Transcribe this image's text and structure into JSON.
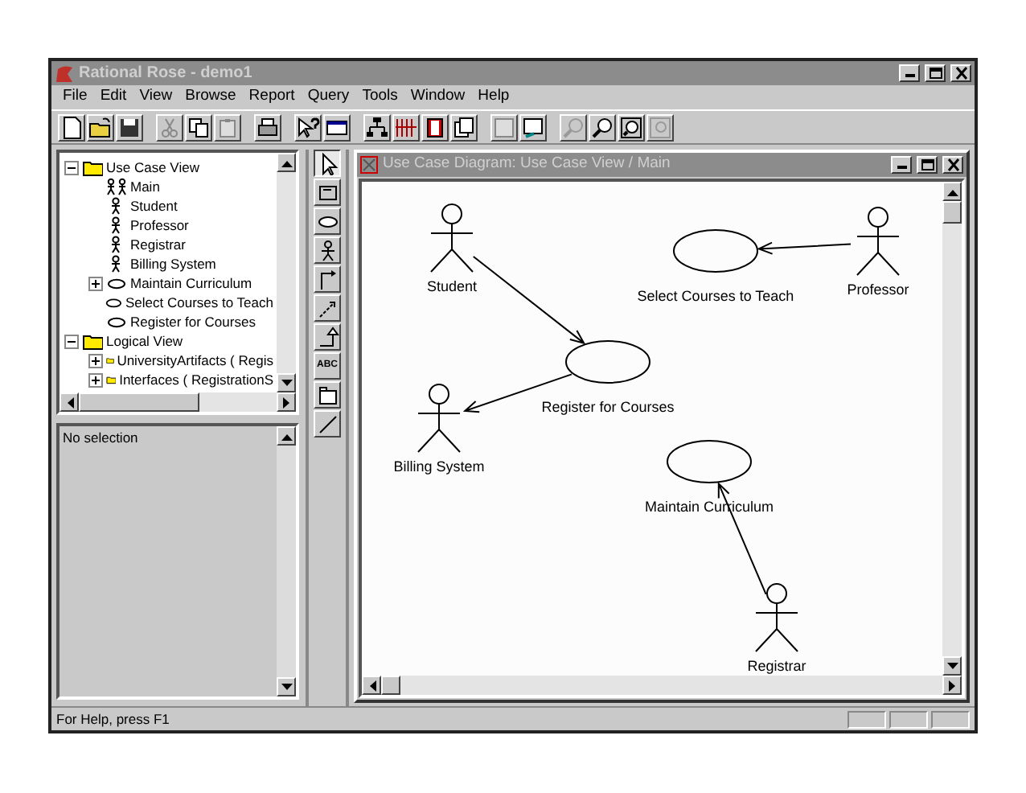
{
  "window": {
    "title": "Rational Rose - demo1"
  },
  "menu": [
    "File",
    "Edit",
    "View",
    "Browse",
    "Report",
    "Query",
    "Tools",
    "Window",
    "Help"
  ],
  "browser": {
    "tree": [
      {
        "label": "Use Case View",
        "kind": "folder",
        "expanded": true,
        "children": [
          {
            "label": "Main",
            "kind": "diagram"
          },
          {
            "label": "Student",
            "kind": "actor"
          },
          {
            "label": "Professor",
            "kind": "actor"
          },
          {
            "label": "Registrar",
            "kind": "actor"
          },
          {
            "label": "Billing System",
            "kind": "actor"
          },
          {
            "label": "Maintain Curriculum",
            "kind": "usecase",
            "expanded": false
          },
          {
            "label": "Select Courses to Teach",
            "kind": "usecase"
          },
          {
            "label": "Register for Courses",
            "kind": "usecase"
          }
        ]
      },
      {
        "label": "Logical View",
        "kind": "folder",
        "expanded": true,
        "children": [
          {
            "label": "UniversityArtifacts ( Regis",
            "kind": "folder",
            "expanded": false
          },
          {
            "label": "Interfaces ( RegistrationS",
            "kind": "folder",
            "expanded": false
          }
        ]
      }
    ]
  },
  "documentation": {
    "text": "No selection"
  },
  "toolbox": [
    {
      "kind": "select",
      "selected": true
    },
    {
      "kind": "note",
      "selected": false
    },
    {
      "kind": "usecase",
      "selected": false
    },
    {
      "kind": "actor",
      "selected": false
    },
    {
      "kind": "anchor",
      "selected": false
    },
    {
      "kind": "dependency",
      "selected": false
    },
    {
      "kind": "generalization",
      "selected": false
    },
    {
      "kind": "text",
      "label": "ABC",
      "selected": false
    },
    {
      "kind": "package",
      "selected": false
    },
    {
      "kind": "association",
      "selected": false
    }
  ],
  "diagram": {
    "title": "Use Case Diagram: Use Case View / Main",
    "elements": [
      {
        "kind": "actor",
        "name": "Student"
      },
      {
        "kind": "usecase",
        "name": "Select Courses to Teach"
      },
      {
        "kind": "actor",
        "name": "Professor"
      },
      {
        "kind": "usecase",
        "name": "Register for Courses"
      },
      {
        "kind": "actor",
        "name": "Billing System"
      },
      {
        "kind": "usecase",
        "name": "Maintain Curriculum"
      },
      {
        "kind": "actor",
        "name": "Registrar"
      }
    ]
  },
  "status_bar": {
    "text": "For Help, press F1"
  }
}
